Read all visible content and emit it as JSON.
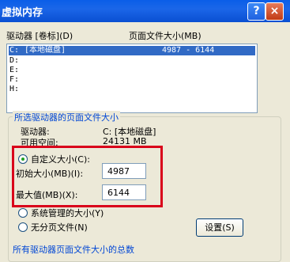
{
  "window": {
    "title": "虚拟内存",
    "help_label": "?",
    "close_label": "×"
  },
  "list": {
    "header_drive": "驱动器 [卷标](D)",
    "header_pagefile": "页面文件大小(MB)",
    "rows": [
      {
        "drive": "C:",
        "label": "[本地磁盘]",
        "size": "4987 - 6144"
      },
      {
        "drive": "D:",
        "label": "",
        "size": ""
      },
      {
        "drive": "E:",
        "label": "",
        "size": ""
      },
      {
        "drive": "F:",
        "label": "",
        "size": ""
      },
      {
        "drive": "H:",
        "label": "",
        "size": ""
      }
    ]
  },
  "selected": {
    "group_title": "所选驱动器的页面文件大小",
    "drive_label": "驱动器:",
    "drive_value": "C: [本地磁盘]",
    "space_label": "可用空间:",
    "space_value": "24131 MB",
    "custom_label": "自定义大小(C):",
    "initial_label": "初始大小(MB)(I):",
    "initial_value": "4987",
    "max_label": "最大值(MB)(X):",
    "max_value": "6144",
    "system_label": "系统管理的大小(Y)",
    "nopage_label": "无分页文件(N)",
    "set_button": "设置(S)"
  },
  "footer": {
    "truncated_label": "所有驱动器页面文件大小的总数"
  },
  "colors": {
    "title_blue": "#0a5ee8",
    "highlight_red": "#d9001a",
    "selection": "#316ac5"
  }
}
